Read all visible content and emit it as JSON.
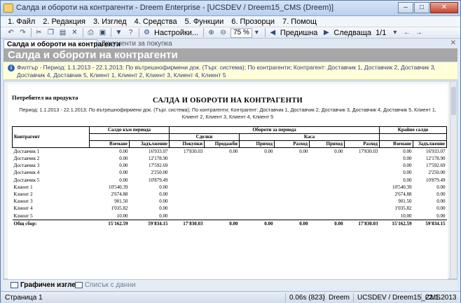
{
  "window": {
    "title": "Салда и обороти на контрагенти - Dreem Enterprise - [UCSDEV / Dreem15_CMS (Dreem)]",
    "buttons": {
      "minimize": "–",
      "maximize": "□",
      "close": "✕"
    }
  },
  "menu": [
    "1. Файл",
    "2. Редакция",
    "3. Изглед",
    "4. Средства",
    "5. Функции",
    "6. Прозорци",
    "7. Помощ"
  ],
  "toolbar": {
    "settings_label": "Настройки...",
    "zoom_value": "75 %",
    "prev_label": "Предишна",
    "next_label": "Следваща",
    "page_value": "1/1"
  },
  "tabs": {
    "active": "Салда и обороти на контрагенти",
    "inactive": "Документи за покупка"
  },
  "header": {
    "title": "Салда и обороти на контрагенти"
  },
  "filter": {
    "text": "Филтър - Период: 1.1.2013 - 22.1.2013; По вътрешнофирмени док. (Търг. система); По контрагенти; Контрагент: Доставчик 1, Доставчик 2, Доставчик 3, Доставчик 4, Доставчик 5, Клиент 1, Клиент 2, Клиент 3, Клиент 4, Клиент 5"
  },
  "report": {
    "customer_label": "Потребител на продукта",
    "title": "САЛДА И ОБОРОТИ НА КОНТРАГЕНТИ",
    "subtitle": "Период: 1.1.2013 - 22.1.2013; По вътрешнофирмени док. (Търг. система); По контрагенти; Контрагент: Доставчик 1, Доставчик 2, Доставчик 3, Доставчик 4, Доставчик 5, Клиент 1, Клиент 2, Клиент 3, Клиент 4, Клиент 5",
    "headers": {
      "counterparty": "Контрагент",
      "opening_balance": "Салдо към периода",
      "turnover": "Обороти за периода",
      "deals": "Сделки",
      "cash": "Каса",
      "bank": "Банка",
      "closing_balance": "Крайно салдо",
      "receivable": "Вземане",
      "liability": "Задължение",
      "purchases": "Покупки",
      "sales": "Продажби",
      "income": "Приход",
      "expense": "Разход"
    },
    "rows": [
      [
        "Доставчик 1",
        "0.00",
        "16'933.07",
        "17'830.03",
        "0.00",
        "0.00",
        "0.00",
        "0.00",
        "17'830.03",
        "0.00",
        "16'933.07"
      ],
      [
        "Доставчик 2",
        "0.00",
        "12'178.90",
        "",
        "",
        "",
        "",
        "",
        "",
        "0.00",
        "12'178.90"
      ],
      [
        "Доставчик 3",
        "0.00",
        "17'592.69",
        "",
        "",
        "",
        "",
        "",
        "",
        "0.00",
        "17'592.69"
      ],
      [
        "Доставчик 4",
        "0.00",
        "2'250.00",
        "",
        "",
        "",
        "",
        "",
        "",
        "0.00",
        "2'250.00"
      ],
      [
        "Доставчик 5",
        "0.00",
        "10'879.49",
        "",
        "",
        "",
        "",
        "",
        "",
        "0.00",
        "10'879.49"
      ],
      [
        "Клиент 1",
        "10'540.39",
        "0.00",
        "",
        "",
        "",
        "",
        "",
        "",
        "10'540.39",
        "0.00"
      ],
      [
        "Клиент 2",
        "2'674.88",
        "0.00",
        "",
        "",
        "",
        "",
        "",
        "",
        "2'674.88",
        "0.00"
      ],
      [
        "Клиент 3",
        "901.50",
        "0.00",
        "",
        "",
        "",
        "",
        "",
        "",
        "901.50",
        "0.00"
      ],
      [
        "Клиент 4",
        "1'035.82",
        "0.00",
        "",
        "",
        "",
        "",
        "",
        "",
        "1'035.82",
        "0.00"
      ],
      [
        "Клиент 5",
        "10.00",
        "0.00",
        "",
        "",
        "",
        "",
        "",
        "",
        "10.00",
        "0.00"
      ]
    ],
    "total": [
      "Общ сбор:",
      "15'162.59",
      "59'834.15",
      "17'830.03",
      "0.00",
      "0.00",
      "0.00",
      "0.00",
      "17'830.03",
      "15'162.59",
      "59'834.15"
    ]
  },
  "bottom_tabs": {
    "active": "Графичен изглед",
    "inactive": "Списък с данни"
  },
  "status": {
    "page": "Страница 1",
    "timing": "0.06s (823)",
    "app": "Dreem",
    "connection": "UCSDEV / Dreem15_CMS",
    "date": "22.1.2013"
  },
  "colors": {
    "header_band": "#a7a7a7",
    "filter_bg": "#ffffd9",
    "filter_text": "#2a3c8a"
  }
}
